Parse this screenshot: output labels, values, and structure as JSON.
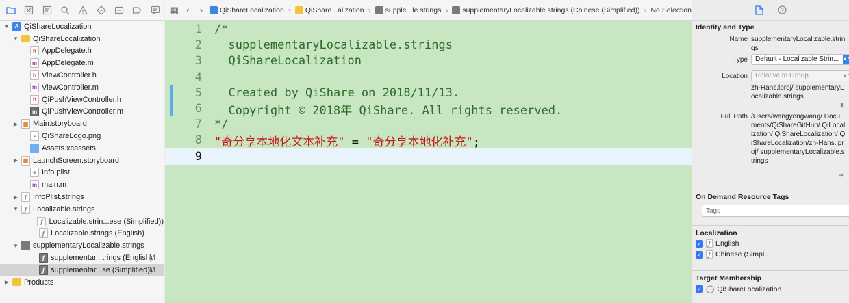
{
  "navigator": {
    "items": [
      {
        "label": "QiShareLocalization",
        "icon": "project-icon",
        "disc": "open",
        "indent": 0
      },
      {
        "label": "QiShareLocalization",
        "icon": "folder-icon",
        "disc": "open",
        "indent": 1
      },
      {
        "label": "AppDelegate.h",
        "icon": "header-file-icon",
        "indent": 2
      },
      {
        "label": "AppDelegate.m",
        "icon": "source-file-icon",
        "indent": 2
      },
      {
        "label": "ViewController.h",
        "icon": "header-file-icon",
        "indent": 2
      },
      {
        "label": "ViewController.m",
        "icon": "source-file-icon",
        "indent": 2
      },
      {
        "label": "QiPushViewController.h",
        "icon": "header-file-icon",
        "indent": 2
      },
      {
        "label": "QiPushViewController.m",
        "icon": "source-file-dark-icon",
        "indent": 2
      },
      {
        "label": "Main.storyboard",
        "icon": "storyboard-icon",
        "disc": "closed",
        "indent": 1
      },
      {
        "label": "QiShareLogo.png",
        "icon": "image-file-icon",
        "indent": 2
      },
      {
        "label": "Assets.xcassets",
        "icon": "assets-icon",
        "indent": 2
      },
      {
        "label": "LaunchScreen.storyboard",
        "icon": "storyboard-icon",
        "disc": "closed",
        "indent": 1
      },
      {
        "label": "Info.plist",
        "icon": "plist-icon",
        "indent": 2
      },
      {
        "label": "main.m",
        "icon": "source-file-icon",
        "indent": 2
      },
      {
        "label": "InfoPlist.strings",
        "icon": "strings-file-icon",
        "disc": "closed",
        "indent": 1
      },
      {
        "label": "Localizable.strings",
        "icon": "strings-file-icon",
        "disc": "open",
        "indent": 1
      },
      {
        "label": "Localizable.strin...ese (Simplified))",
        "icon": "strings-file-icon",
        "indent": 3
      },
      {
        "label": "Localizable.strings (English)",
        "icon": "strings-file-icon",
        "indent": 3
      },
      {
        "label": "supplementaryLocalizable.strings",
        "icon": "strings-group-icon",
        "disc": "open",
        "indent": 1
      },
      {
        "label": "supplementar...trings (English)",
        "icon": "strings-file-dark-icon",
        "indent": 3,
        "badge": "M"
      },
      {
        "label": "supplementar...se (Simplified))",
        "icon": "strings-file-dark-icon",
        "indent": 3,
        "badge": "M",
        "selected": true
      },
      {
        "label": "Products",
        "icon": "folder-icon",
        "disc": "closed",
        "indent": 0
      }
    ]
  },
  "jumpbar": {
    "segments": [
      "QiShareLocalization",
      "QiShare...alization",
      "supple...le.strings",
      "supplementaryLocalizable.strings (Chinese (Simplified))",
      "No Selection"
    ]
  },
  "editor": {
    "lines": [
      {
        "num": "1",
        "text": "/*",
        "kind": "comment"
      },
      {
        "num": "2",
        "text": "  supplementaryLocalizable.strings",
        "kind": "comment"
      },
      {
        "num": "3",
        "text": "  QiShareLocalization",
        "kind": "comment"
      },
      {
        "num": "4",
        "text": "",
        "kind": "comment"
      },
      {
        "num": "5",
        "text": "  Created by QiShare on 2018/11/13.",
        "kind": "comment"
      },
      {
        "num": "6",
        "text": "  Copyright © 2018年 QiShare. All rights reserved.",
        "kind": "comment"
      },
      {
        "num": "7",
        "text": "*/",
        "kind": "comment"
      },
      {
        "num": "8",
        "key": "\"奇分享本地化文本补充\"",
        "op": " = ",
        "value": "\"奇分享本地化补充\"",
        "end": ";",
        "kind": "entry"
      },
      {
        "num": "9",
        "text": "",
        "kind": "current"
      }
    ]
  },
  "inspector": {
    "identity_title": "Identity and Type",
    "name_label": "Name",
    "name_value": "supplementaryLocalizable.strings",
    "type_label": "Type",
    "type_value": "Default - Localizable Strin...",
    "location_label": "Location",
    "location_value": "Relative to Group",
    "location_path": "zh-Hans.lproj/ supplementaryLocalizable.strings",
    "fullpath_label": "Full Path",
    "fullpath_value": "/Users/wangyongwang/ Documents/QiShareGitHub/ QiLocalization/ QiShareLocalization/ QiShareLocalization/zh-Hans.lproj/ supplementaryLocalizable.strings",
    "ondemand_title": "On Demand Resource Tags",
    "tags_placeholder": "Tags",
    "localization_title": "Localization",
    "localizations": [
      "English",
      "Chinese (Simpl..."
    ],
    "target_title": "Target Membership",
    "targets": [
      "QiShareLocalization"
    ]
  }
}
